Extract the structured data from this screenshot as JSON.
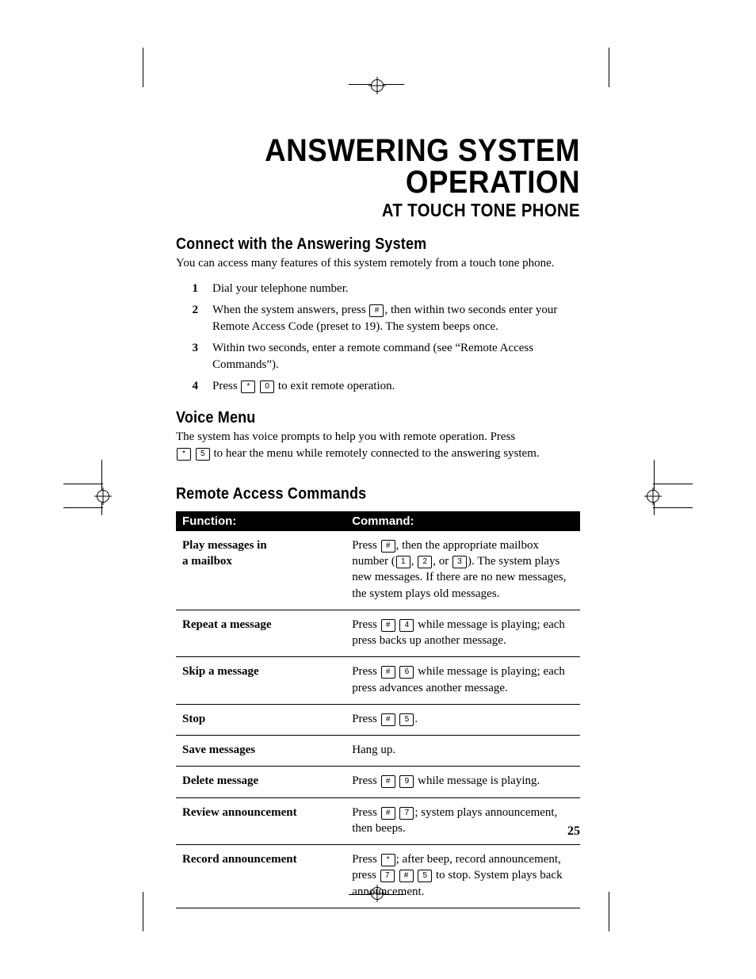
{
  "title": "ANSWERING SYSTEM OPERATION",
  "subtitle": "AT TOUCH TONE PHONE",
  "sections": {
    "connect": {
      "heading": "Connect with the Answering System",
      "intro": "You can access many features of this system remotely from a touch tone phone.",
      "steps": [
        {
          "n": "1",
          "pre": "Dial your telephone number."
        },
        {
          "n": "2",
          "pre": "When the system answers, press ",
          "k1": "#",
          "post": ", then within two seconds enter your Remote Access Code (preset to 19). The system beeps once."
        },
        {
          "n": "3",
          "pre": "Within two seconds, enter a remote command (see “Remote Access Commands”)."
        },
        {
          "n": "4",
          "pre": "Press ",
          "k1": "*",
          "k2": "0",
          "post": " to exit remote operation."
        }
      ]
    },
    "voice": {
      "heading": "Voice Menu",
      "line1": "The system has voice prompts to help you with remote operation.  Press",
      "k1": "*",
      "k2": "5",
      "line2": " to hear the menu while remotely connected to the answering system."
    },
    "commands": {
      "heading": "Remote Access Commands",
      "th_function": "Function:",
      "th_command": "Command:",
      "rows": [
        {
          "fn": "Play messages in a mailbox",
          "pre": "Press ",
          "k1": "#",
          "mid1": ", then the appropriate mailbox number (",
          "k2": "1",
          "mid2": ", ",
          "k3": "2",
          "mid3": ", or ",
          "k4": "3",
          "post": "). The system plays new messages.  If there are no new messages, the system plays old messages."
        },
        {
          "fn": "Repeat a message",
          "pre": "Press ",
          "k1": "#",
          "k2": "4",
          "post": " while message is playing; each press backs up another message."
        },
        {
          "fn": "Skip a message",
          "pre": "Press ",
          "k1": "#",
          "k2": "6",
          "post": " while message is playing; each press advances another message."
        },
        {
          "fn": "Stop",
          "pre": "Press ",
          "k1": "#",
          "k2": "5",
          "post": "."
        },
        {
          "fn": "Save messages",
          "pre": "Hang up."
        },
        {
          "fn": "Delete message",
          "pre": "Press ",
          "k1": "#",
          "k2": "9",
          "post": " while message is playing."
        },
        {
          "fn": "Review announcement",
          "pre": "Press ",
          "k1": "#",
          "k2": "7",
          "post": "; system plays announcement, then beeps."
        },
        {
          "fn": "Record announcement",
          "pre": "Press ",
          "k1": "*",
          "k2": "7",
          "mid1": "; after beep, record announcement, press ",
          "k3": "#",
          "k4": "5",
          "post": " to stop. System plays back announcement."
        }
      ]
    }
  },
  "page_number": "25"
}
